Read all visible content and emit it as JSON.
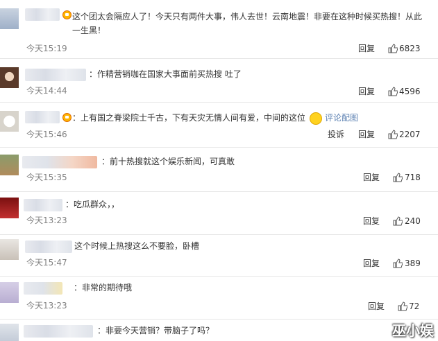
{
  "comments": [
    {
      "text": "这个团太会隔应人了！今天只有两件大事，伟人去世！云南地震！非要在这种时候买热搜！从此一生黑！",
      "time": "今天15:19",
      "reply": "回复",
      "likes": "6823"
    },
    {
      "text": "：作精营销咖在国家大事面前买热搜 吐了",
      "time": "今天14:44",
      "reply": "回复",
      "likes": "4596"
    },
    {
      "text": "：上有国之脊梁院士千古，下有天灾无情人间有爱，中间的这位",
      "link": "评论配图",
      "time": "今天15:46",
      "report": "投诉",
      "reply": "回复",
      "likes": "2207"
    },
    {
      "text": "：前十热搜就这个娱乐新闻，可真敢",
      "time": "今天15:35",
      "reply": "回复",
      "likes": "718"
    },
    {
      "text": "：吃瓜群众，，",
      "time": "今天13:23",
      "reply": "回复",
      "likes": "240"
    },
    {
      "text": "这个时候上热搜这么不要脸，卧槽",
      "time": "今天15:47",
      "reply": "回复",
      "likes": "389"
    },
    {
      "text": "：非常的期待哦",
      "time": "今天13:23",
      "reply": "回复",
      "likes": "72"
    },
    {
      "text": "：非要今天营销？带脑子了吗？",
      "time": "",
      "reply": "",
      "likes": ""
    }
  ],
  "watermark": "巫小娱",
  "colors": {
    "link": "#5b80b2",
    "time": "#808080",
    "text": "#333333"
  }
}
